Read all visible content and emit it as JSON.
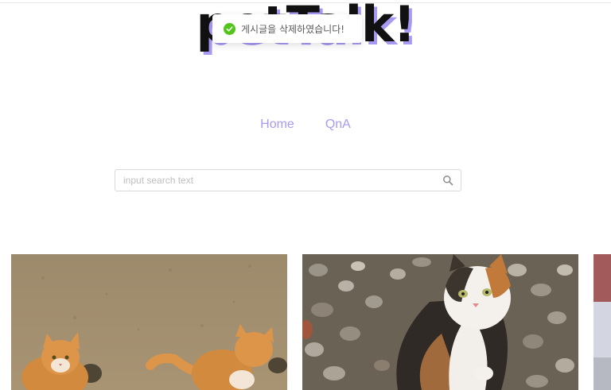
{
  "logo": {
    "text": "petTalk!"
  },
  "toast": {
    "message": "게시글을 삭제하였습니다!",
    "icon": "check-circle-icon",
    "color": "#52c41a"
  },
  "nav": {
    "items": [
      {
        "label": "Home"
      },
      {
        "label": "QnA"
      }
    ]
  },
  "search": {
    "placeholder": "input search text",
    "value": "",
    "icon": "search-icon"
  },
  "posts": [
    {
      "image": "two orange and white cats sitting on pavement"
    },
    {
      "image": "calico cat sitting on gravel"
    },
    {
      "image": "partially visible photo"
    }
  ],
  "colors": {
    "accent": "#a99af2",
    "success": "#52c41a",
    "border": "#d9d9d9"
  }
}
